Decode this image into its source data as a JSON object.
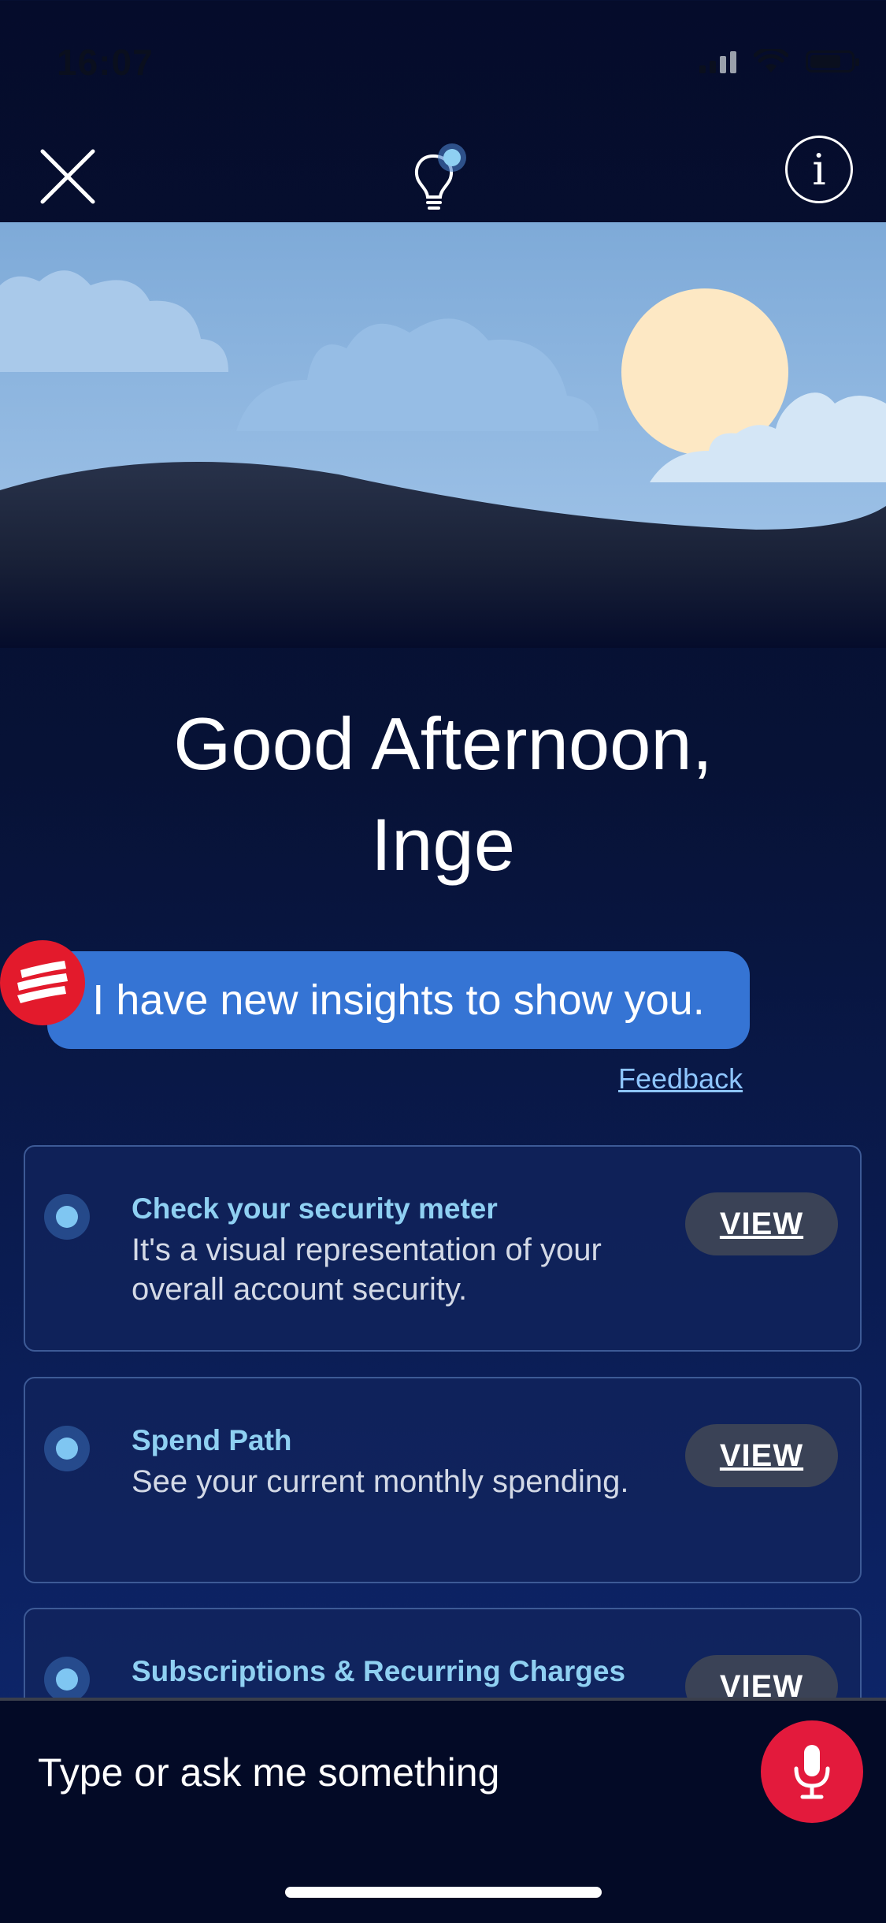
{
  "status_bar": {
    "time": "16:07"
  },
  "greeting": {
    "line1": "Good Afternoon,",
    "line2": "Inge"
  },
  "chat": {
    "message": "I have new insights to show you.",
    "feedback_label": "Feedback"
  },
  "insights": [
    {
      "title": "Check your security meter",
      "description": "It's a visual representation of your overall account security.",
      "button": "VIEW"
    },
    {
      "title": "Spend Path",
      "description": "See your current monthly spending.",
      "button": "VIEW"
    },
    {
      "title": "Subscriptions & Recurring Charges",
      "description": "",
      "button": "VIEW"
    }
  ],
  "composer": {
    "placeholder": "Type or ask me something"
  },
  "colors": {
    "accent": "#3574d4",
    "brand_red": "#e31a2c",
    "link": "#8ec5ff",
    "card_title": "#8fd0f2"
  }
}
